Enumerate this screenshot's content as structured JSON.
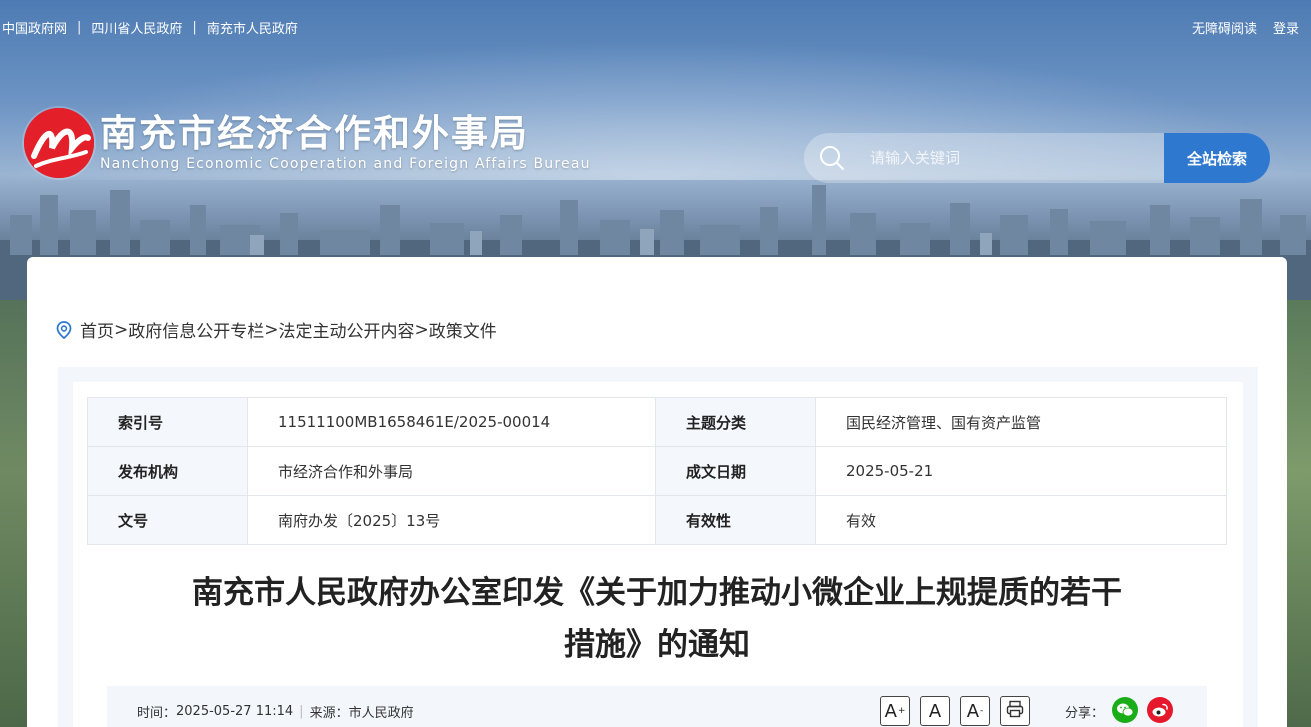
{
  "topbar": {
    "links": [
      "中国政府网",
      "四川省人民政府",
      "南充市人民政府"
    ],
    "separator": "|",
    "accessibility": "无障碍阅读",
    "login": "登录"
  },
  "header": {
    "title_cn": "南充市经济合作和外事局",
    "title_en": "Nanchong Economic Cooperation and Foreign Affairs Bureau"
  },
  "search": {
    "placeholder": "请输入关键词",
    "button": "全站检索",
    "button_color": "#2f78cf"
  },
  "breadcrumb": {
    "items": [
      "首页",
      "政府信息公开专栏",
      "法定主动公开内容",
      "政策文件"
    ],
    "separator": ">"
  },
  "meta": {
    "rows": [
      {
        "k1": "索引号",
        "v1": "11511100MB1658461E/2025-00014",
        "k2": "主题分类",
        "v2": "国民经济管理、国有资产监管"
      },
      {
        "k1": "发布机构",
        "v1": "市经济合作和外事局",
        "k2": "成文日期",
        "v2": "2025-05-21"
      },
      {
        "k1": "文号",
        "v1": "南府办发〔2025〕13号",
        "k2": "有效性",
        "v2": "有效"
      }
    ]
  },
  "article": {
    "title_line1": "南充市人民政府办公室印发《关于加力推动小微企业上规提质的若干",
    "title_line2": "措施》的通知",
    "time_label": "时间：",
    "time": "2025-05-27 11:14",
    "source_label": "来源：",
    "source": "市人民政府",
    "font_large": "A",
    "font_large_sup": "+",
    "font_normal": "A",
    "font_small": "A",
    "font_small_sup": "-",
    "share_label": "分享："
  },
  "colors": {
    "accent": "#2f78cf",
    "logo_red": "#e3202a",
    "wechat_green": "#1aad19",
    "weibo_red": "#e6162d"
  }
}
